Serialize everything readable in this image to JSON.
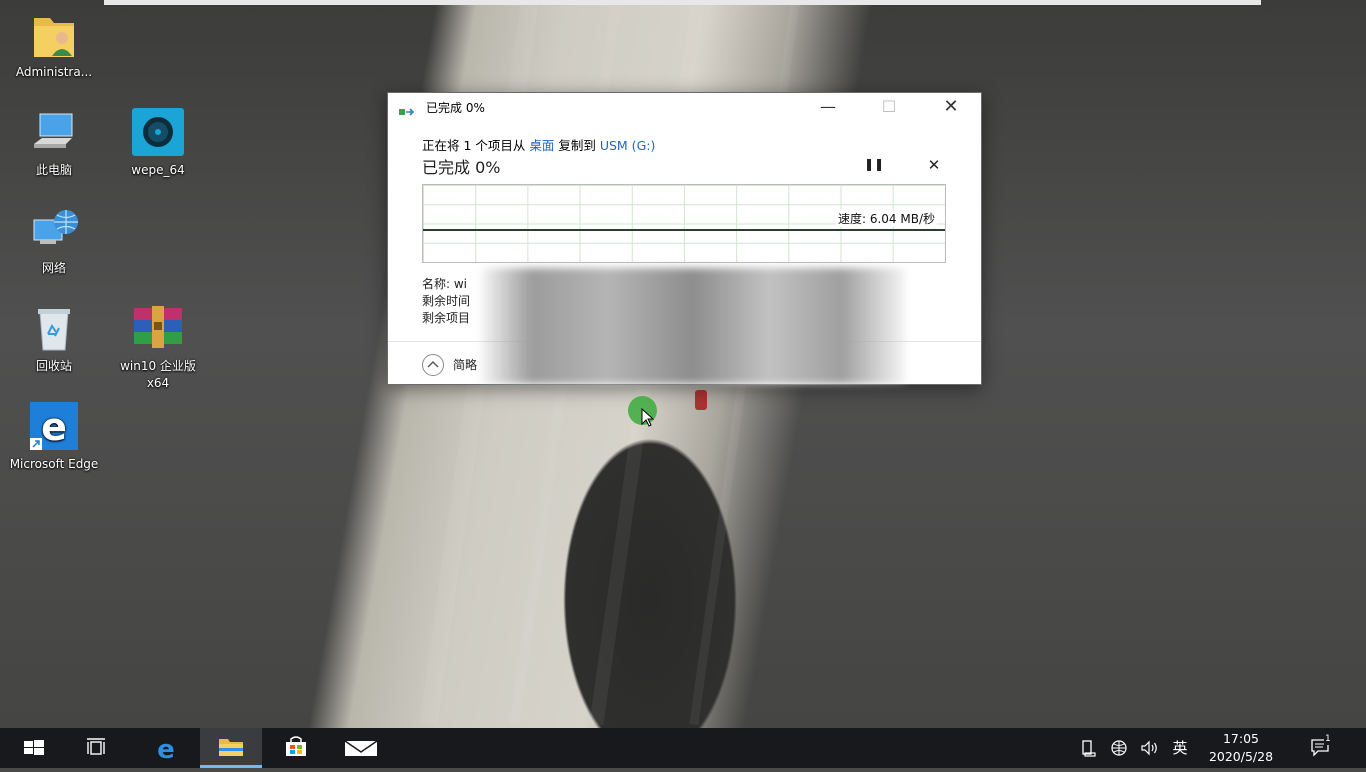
{
  "desktop": {
    "icons": [
      {
        "label": "Administra..."
      },
      {
        "label": "此电脑"
      },
      {
        "label": "wepe_64"
      },
      {
        "label": "网络"
      },
      {
        "label": "回收站"
      },
      {
        "label": "win10 企业版 x64"
      },
      {
        "label": "Microsoft Edge"
      }
    ]
  },
  "dialog": {
    "title": "已完成 0%",
    "copy_line": {
      "prefix": "正在将 1 个项目从 ",
      "source": "桌面",
      "middle": " 复制到 ",
      "destination": "USM (G:)"
    },
    "status": "已完成 0%",
    "speed": "速度: 6.04 MB/秒",
    "progress_percent": 0,
    "name_label": "名称: wi",
    "time_left_label": "剩余时间",
    "items_left_label": "剩余项目",
    "details_label": "简略"
  },
  "taskbar": {
    "input_method": "英",
    "time": "17:05",
    "date": "2020/5/28",
    "notification_count": "1"
  },
  "colors": {
    "link": "#1a66c2",
    "taskbar": "#17191c",
    "active_indicator": "#76b9ed",
    "graph_grid": "#cfe6cf"
  }
}
